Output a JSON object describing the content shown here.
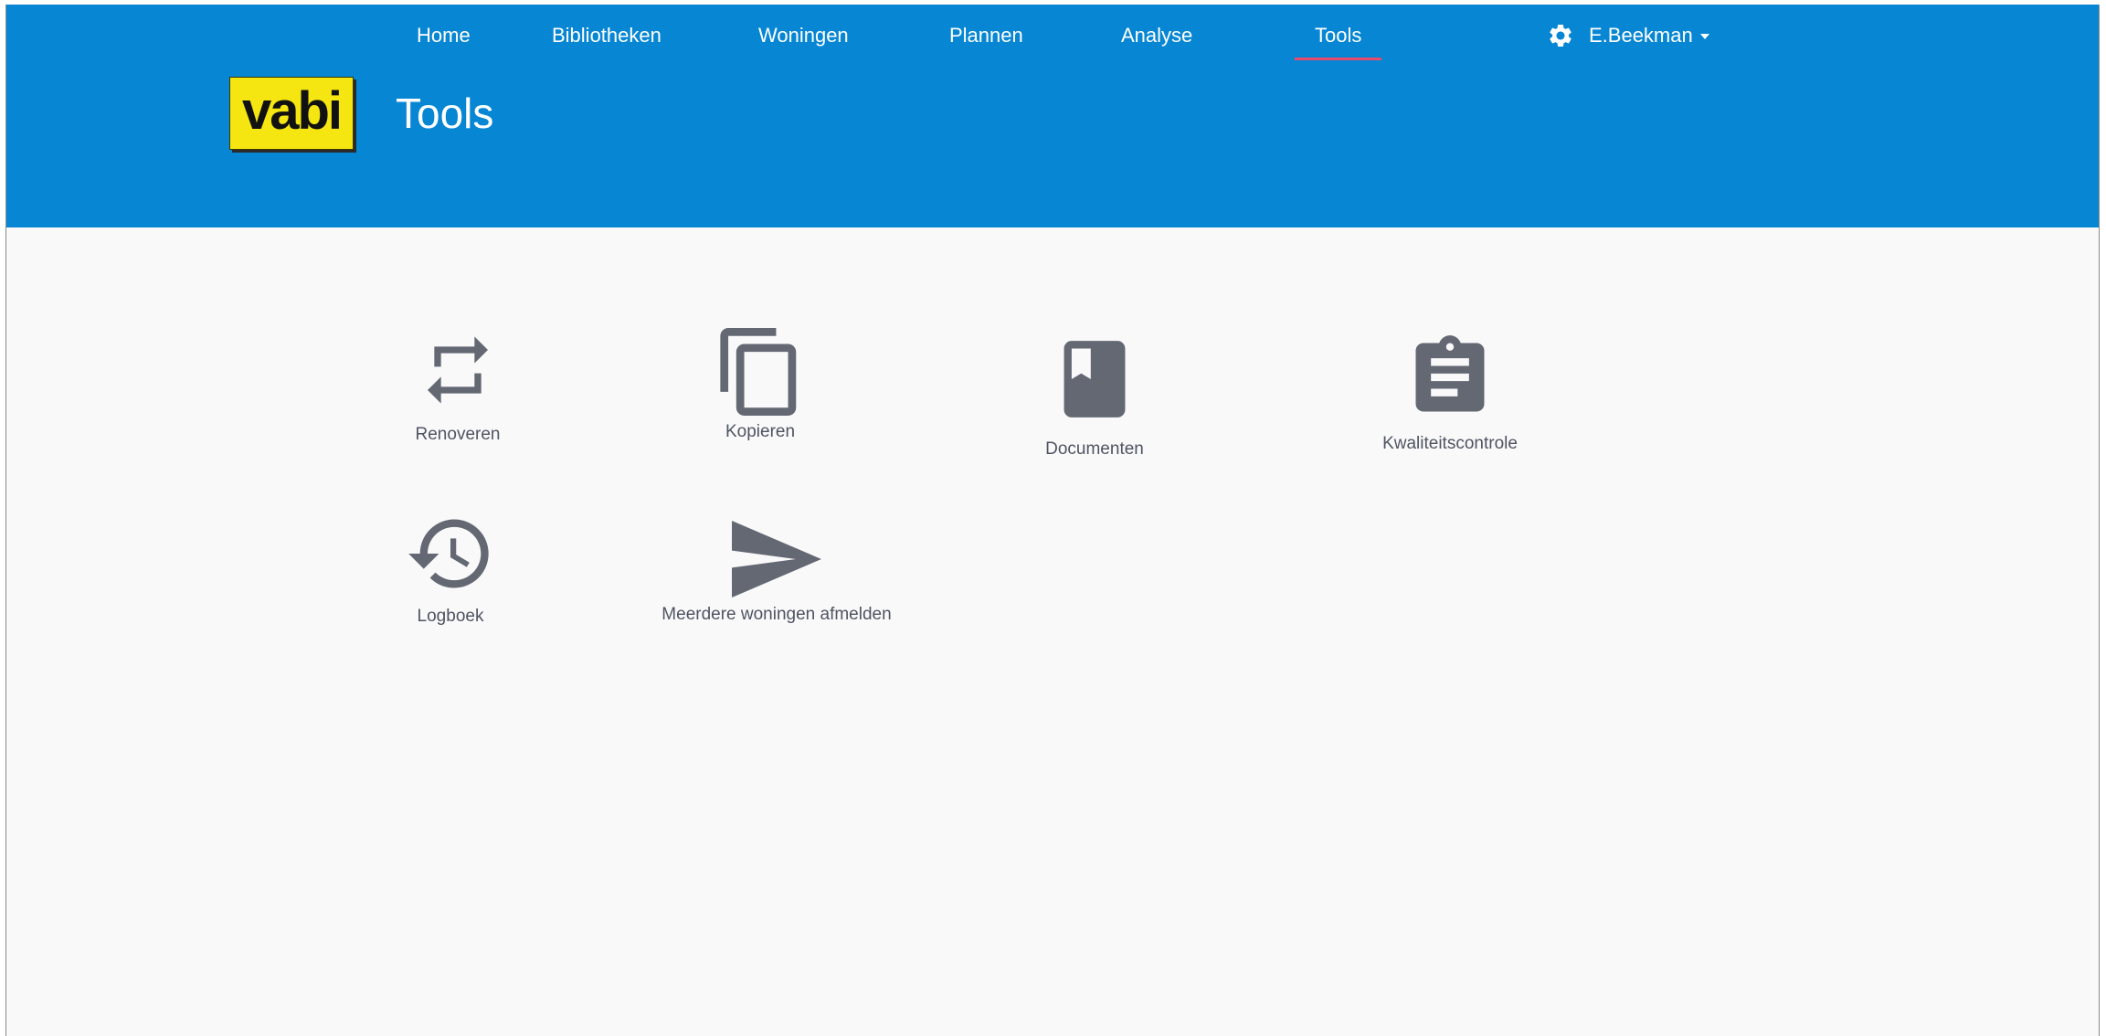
{
  "nav": {
    "items": [
      {
        "label": "Home"
      },
      {
        "label": "Bibliotheken"
      },
      {
        "label": "Woningen"
      },
      {
        "label": "Plannen"
      },
      {
        "label": "Analyse"
      },
      {
        "label": "Tools"
      }
    ],
    "active": "Tools",
    "user": "E.Beekman"
  },
  "logo": {
    "text": "vabi"
  },
  "page": {
    "title": "Tools"
  },
  "tools": [
    {
      "label": "Renoveren",
      "icon": "repeat-icon"
    },
    {
      "label": "Kopieren",
      "icon": "copy-icon"
    },
    {
      "label": "Documenten",
      "icon": "book-icon"
    },
    {
      "label": "Kwaliteitscontrole",
      "icon": "clipboard-icon"
    },
    {
      "label": "Logboek",
      "icon": "history-icon"
    },
    {
      "label": "Meerdere woningen afmelden",
      "icon": "send-icon"
    }
  ],
  "colors": {
    "header": "#0786d4",
    "active_underline": "#ea4a6a",
    "logo_bg": "#f5e511",
    "icon": "#646873",
    "page_bg": "#f9f9fa"
  }
}
